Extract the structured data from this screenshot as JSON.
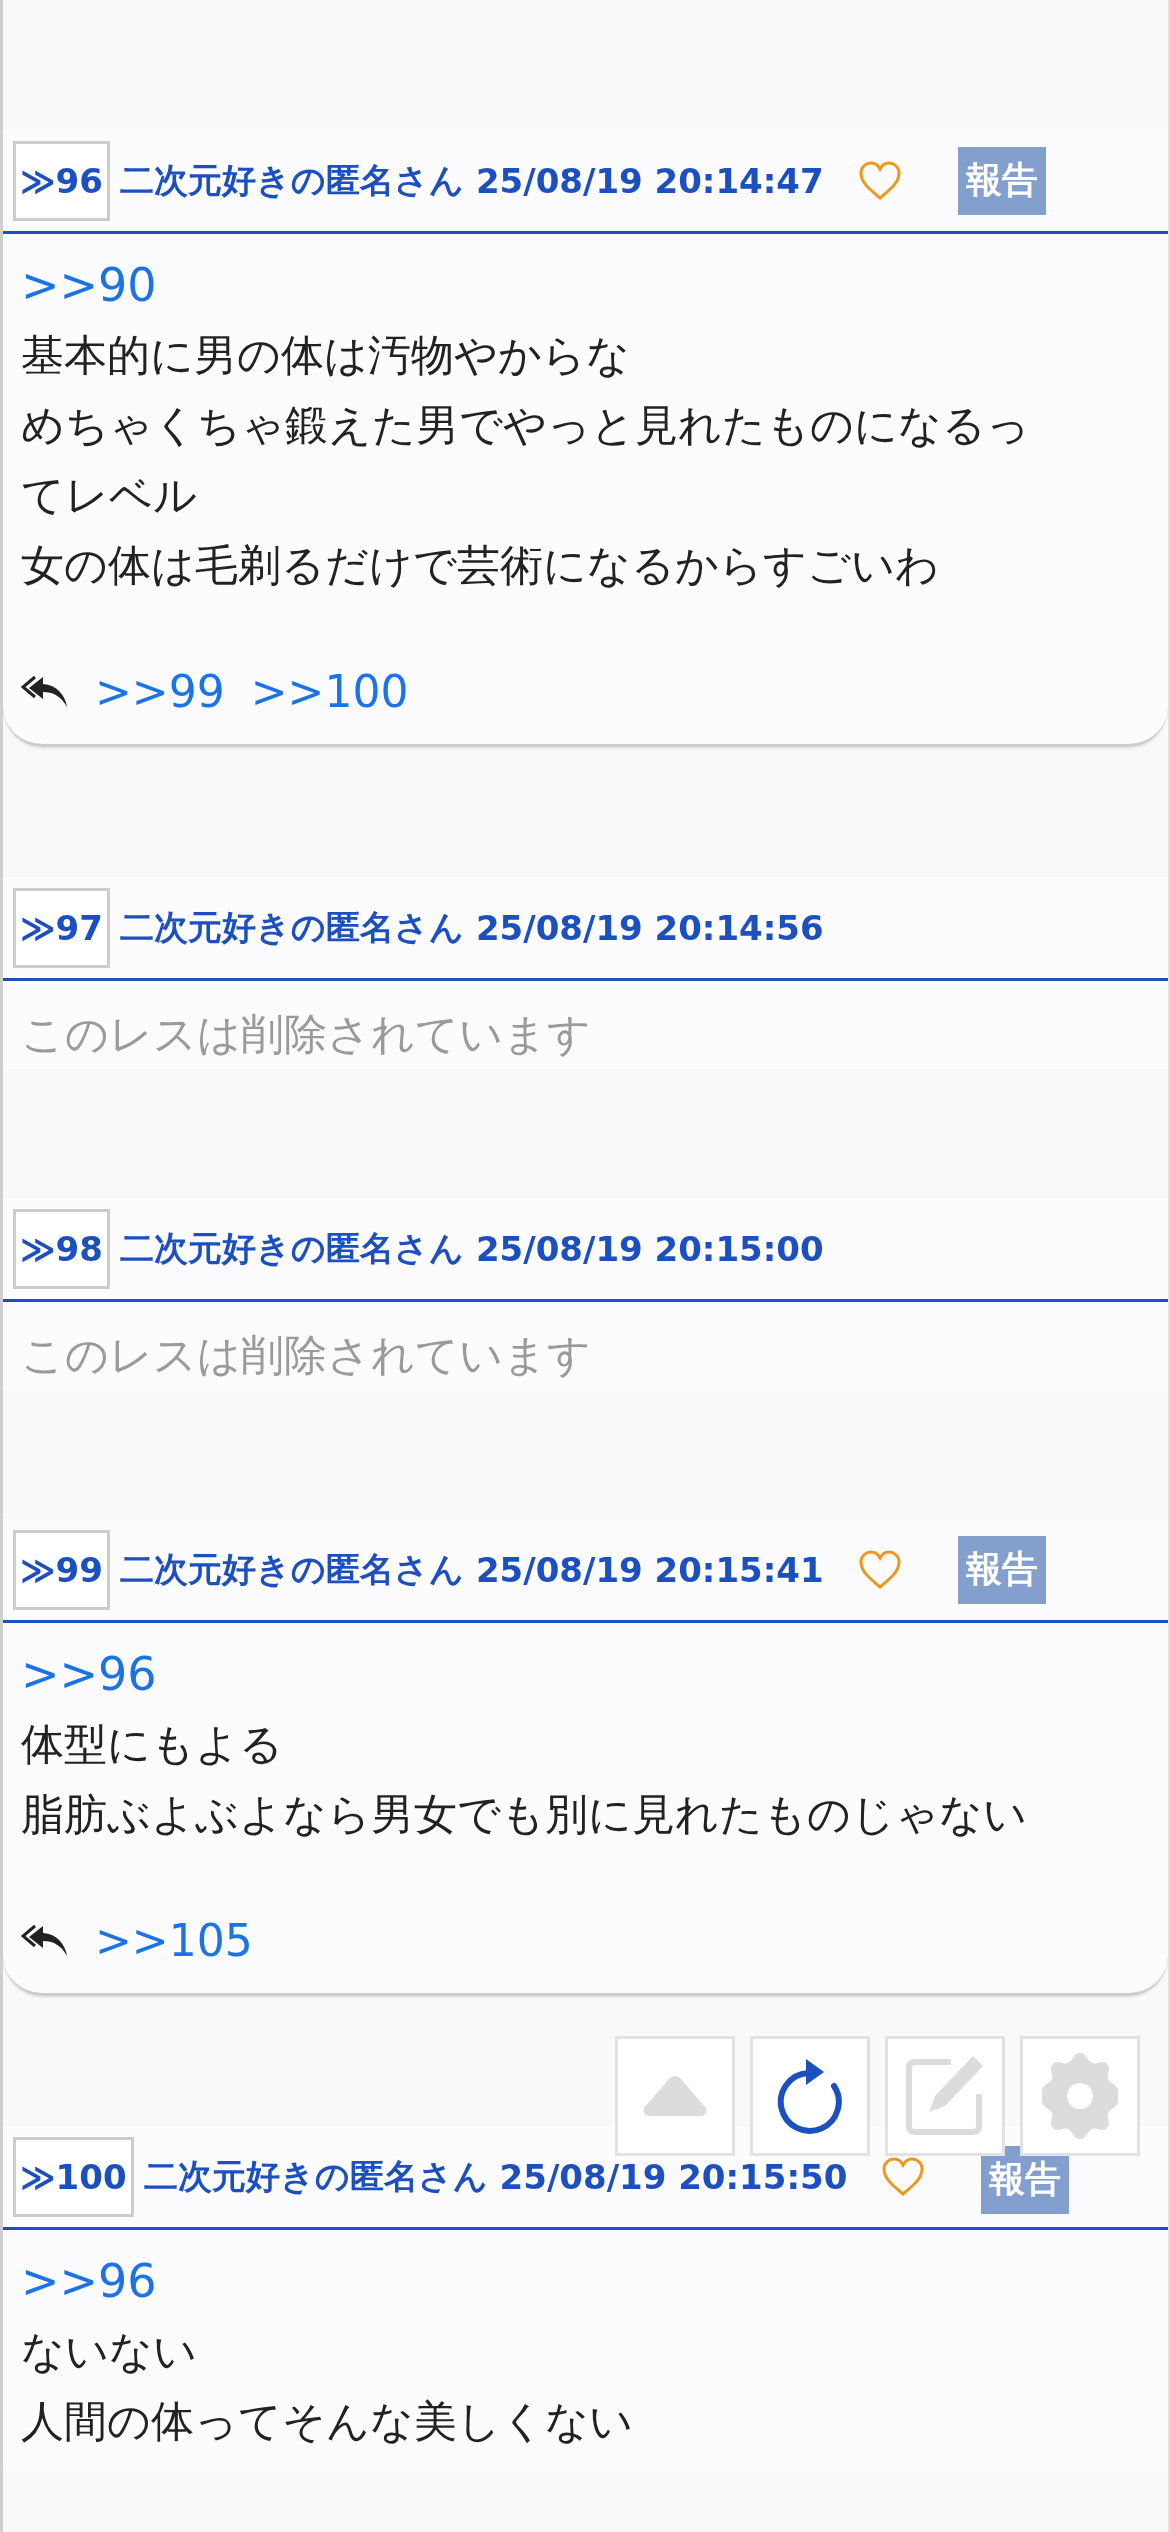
{
  "posts": [
    {
      "kind": "post",
      "number": "≫96",
      "author": "二次元好きの匿名さん",
      "date": "25/08/19 20:14:47",
      "liked": false,
      "report": "報告",
      "anchor": ">>90",
      "lines": [
        "基本的に男の体は汚物やからな",
        "めちゃくちゃ鍛えた男でやっと見れたものになるっ",
        "てレベル",
        "女の体は毛剃るだけで芸術になるからすごいわ"
      ],
      "replies": [
        ">>99",
        ">>100"
      ]
    },
    {
      "kind": "deleted",
      "number": "≫97",
      "author": "二次元好きの匿名さん",
      "date": "25/08/19 20:14:56",
      "message": "このレスは削除されています"
    },
    {
      "kind": "deleted",
      "number": "≫98",
      "author": "二次元好きの匿名さん",
      "date": "25/08/19 20:15:00",
      "message": "このレスは削除されています"
    },
    {
      "kind": "post",
      "number": "≫99",
      "author": "二次元好きの匿名さん",
      "date": "25/08/19 20:15:41",
      "liked": false,
      "report": "報告",
      "anchor": ">>96",
      "lines": [
        "体型にもよる",
        "脂肪ぶよぶよなら男女でも別に見れたものじゃない"
      ],
      "replies": [
        ">>105"
      ]
    },
    {
      "kind": "open",
      "number": "≫100",
      "author": "二次元好きの匿名さん",
      "date": "25/08/19 20:15:50",
      "liked": false,
      "report": "報告",
      "anchor": ">>96",
      "lines": [
        "ないない",
        "人間の体ってそんな美しくない"
      ]
    }
  ],
  "floating_buttons": [
    {
      "kind": "top",
      "enabled": false
    },
    {
      "kind": "reload",
      "enabled": true
    },
    {
      "kind": "compose",
      "enabled": false
    },
    {
      "kind": "settings",
      "enabled": false
    }
  ]
}
